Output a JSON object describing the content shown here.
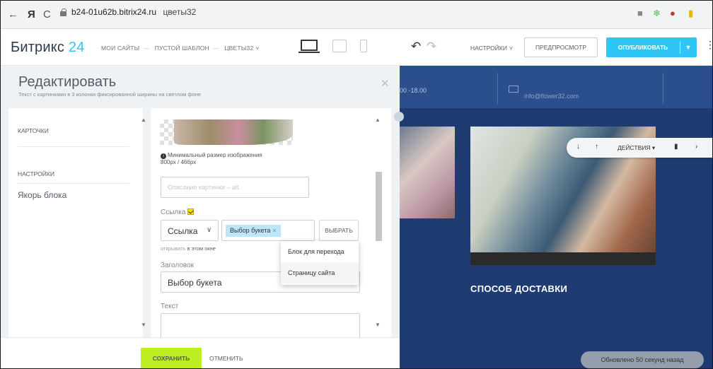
{
  "browser": {
    "back": "←",
    "yandex": "Я",
    "reload": "C",
    "domain": "b24-01u62b.bitrix24.ru",
    "page_title": "цветы32"
  },
  "header": {
    "logo_main": "Битрикс",
    "logo_num": "24",
    "breadcrumbs": [
      "МОИ САЙТЫ",
      "ПУСТОЙ ШАБЛОН",
      "ЦВЕТЫ32"
    ],
    "settings": "НАСТРОЙКИ",
    "preview": "ПРЕДПРОСМОТР",
    "publish": "ОПУБЛИКОВАТЬ"
  },
  "editor": {
    "title": "Редактировать",
    "subtitle": "Текст с картинками в 3 колонки фиксированной ширины на светлом фоне",
    "nav": {
      "cards": "КАРТОЧКИ",
      "settings": "НАСТРОЙКИ",
      "anchor": "Якорь блока"
    },
    "min_size": "Минимальный размер изображения",
    "min_size_px": "800px / 466px",
    "alt_placeholder": "Описание картинки – alt.",
    "link_label": "Ссылка",
    "link_type": "Ссылка",
    "link_tag": "Выбор букета",
    "choose": "ВЫБРАТЬ",
    "opens_prefix": "открывать",
    "opens_value": "в этом окне",
    "heading_label": "Заголовок",
    "heading_value": "Выбор букета",
    "text_label": "Текст",
    "dropdown": [
      "Блок для перехода",
      "Страницу сайта"
    ],
    "save": "СОХРАНИТЬ",
    "cancel": "ОТМЕНИТЬ"
  },
  "site": {
    "hours": "00 -18.00",
    "email": "info@flower32.com",
    "heading": "СПОСОБ ДОСТАВКИ",
    "actions": "ДЕЙСТВИЯ",
    "updated": "Обновлено 50 секунд назад"
  },
  "colors": {
    "accent": "#2fc6f6",
    "save": "#bbed21",
    "site_bg": "#1e3c72"
  }
}
